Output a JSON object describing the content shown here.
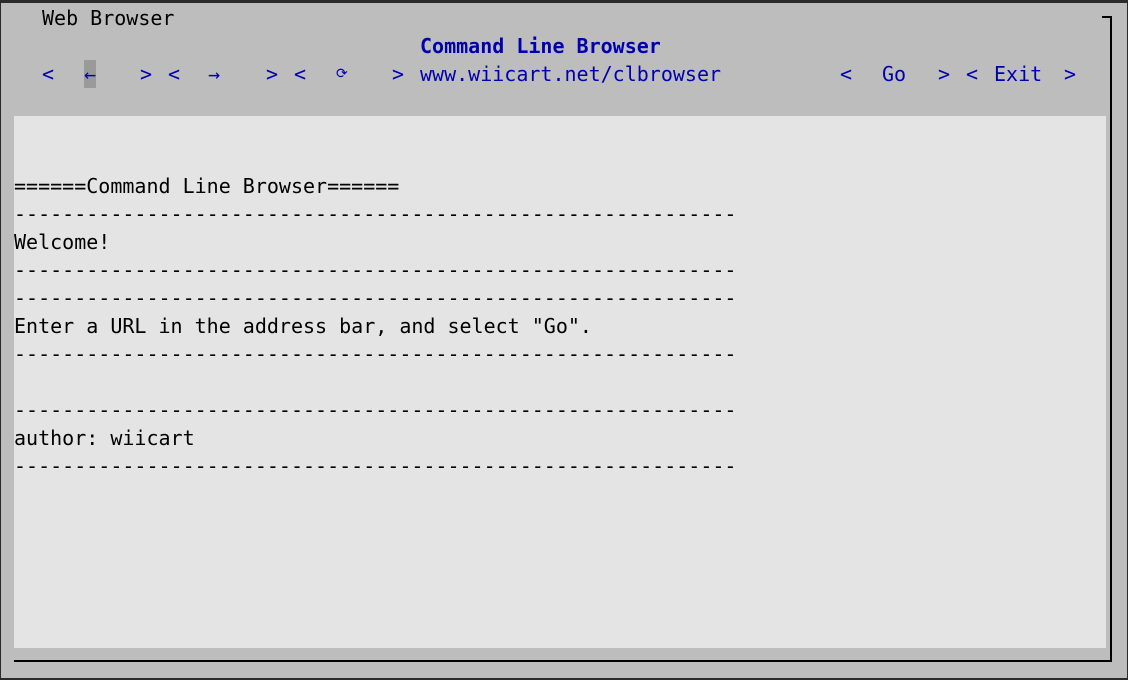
{
  "window": {
    "title": "Web Browser"
  },
  "browser": {
    "title": "Command Line Browser"
  },
  "toolbar": {
    "back_left_bracket": "<",
    "back_icon": "←",
    "back_right_bracket": ">",
    "forward_left_bracket": "<",
    "forward_icon": "→",
    "forward_right_bracket": ">",
    "reload_left_bracket": "<",
    "reload_icon": "⟳",
    "reload_right_bracket": ">",
    "address_value": "www.wiicart.net/clbrowser",
    "go_left_bracket": "<",
    "go_label": "Go",
    "go_right_bracket": ">",
    "exit_left_bracket": "<",
    "exit_label": "Exit",
    "exit_right_bracket": ">"
  },
  "page": {
    "lines": [
      "======Command Line Browser======",
      "------------------------------------------------------------",
      "Welcome!",
      "------------------------------------------------------------",
      "------------------------------------------------------------",
      "Enter a URL in the address bar, and select \"Go\".",
      "------------------------------------------------------------",
      "------------------------------------------------------------",
      "author: wiicart",
      "------------------------------------------------------------"
    ]
  },
  "colors": {
    "accent": "#0000b0",
    "dialog_bg": "#bdbdbd",
    "content_bg": "#e4e4e4",
    "selected_bg": "#9a9a9a"
  }
}
